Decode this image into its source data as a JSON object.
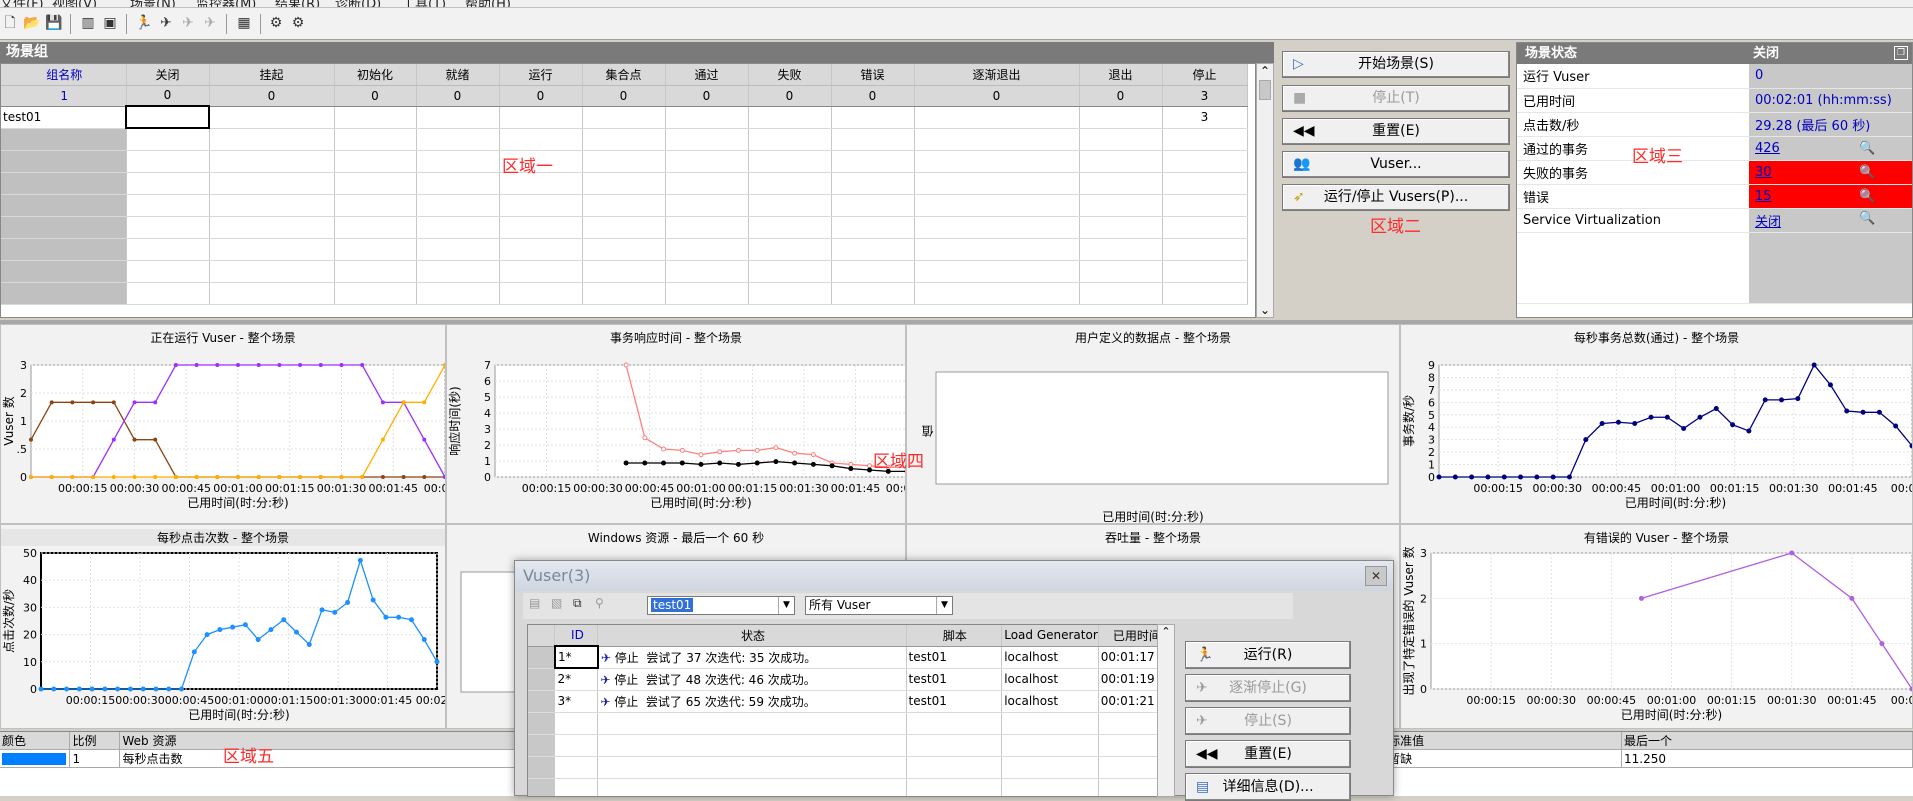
{
  "menu": [
    "文件(F)",
    "视图(V)",
    "场景(N)",
    "监控器(M)",
    "结果(R)",
    "诊断(D)",
    "工具(T)",
    "帮助(H)"
  ],
  "scenario_group": {
    "title": "场景组",
    "columns": [
      "组名称",
      "关闭",
      "挂起",
      "初始化",
      "就绪",
      "运行",
      "集合点",
      "通过",
      "失败",
      "错误",
      "逐渐退出",
      "退出",
      "停止"
    ],
    "totals": [
      "1",
      "0",
      "0",
      "0",
      "0",
      "0",
      "0",
      "0",
      "0",
      "0",
      "0",
      "0",
      "3"
    ],
    "rows": [
      {
        "name": "test01",
        "stop": "3"
      }
    ]
  },
  "annotations": {
    "area1": "区域一",
    "area2": "区域二",
    "area3": "区域三",
    "area4": "区域四",
    "area5": "区域五"
  },
  "controls": {
    "start": "开始场景(S)",
    "stop": "停止(T)",
    "reset": "重置(E)",
    "vusers": "Vuser...",
    "run_stop_vusers": "运行/停止 Vusers(P)..."
  },
  "scenario_status": {
    "title": "场景状态",
    "close_label": "关闭",
    "rows": [
      {
        "label": "运行 Vuser",
        "value": "0"
      },
      {
        "label": "已用时间",
        "value": "00:02:01 (hh:mm:ss)"
      },
      {
        "label": "点击数/秒",
        "value": "29.28 (最后 60 秒)"
      },
      {
        "label": "通过的事务",
        "value": "426"
      },
      {
        "label": "失败的事务",
        "value": "30"
      },
      {
        "label": "错误",
        "value": "15"
      },
      {
        "label": "Service Virtualization",
        "value": "关闭"
      }
    ]
  },
  "graphs": {
    "running_vusers": "正在运行 Vuser - 整个场景",
    "txn_response": "事务响应时间 - 整个场景",
    "user_defined": "用户定义的数据点 - 整个场景",
    "tps": "每秒事务总数(通过) - 整个场景",
    "hits": "每秒点击次数 - 整个场景",
    "windows": "Windows 资源 - 最后一个 60 秒",
    "throughput": "吞吐量 - 整个场景",
    "error_vusers": "有错误的 Vuser - 整个场景",
    "elapsed_label": "已用时间(时:分:秒)",
    "x_ticks": [
      "00:00:15",
      "00:00:30",
      "00:00:45",
      "00:01:00",
      "00:01:15",
      "00:01:30",
      "00:01:45",
      "00:02:0"
    ],
    "ylabels": {
      "running_vusers": "Vuser 数",
      "txn_response": "响应时间(秒)",
      "user_defined": "值",
      "tps": "事务数/秒",
      "hits": "点击次数/秒",
      "error_vusers": "出现了特定错误的 Vuser 数"
    }
  },
  "chart_data": [
    {
      "type": "line",
      "title": "正在运行 Vuser - 整个场景",
      "xlabel": "已用时间(时:分:秒)",
      "ylabel": "Vuser 数",
      "ylim": [
        0,
        3
      ],
      "yticks": [
        "3",
        "2",
        "1",
        ".5",
        "0"
      ],
      "series": [
        {
          "color": "#8b4513",
          "values": [
            1,
            2,
            2,
            2,
            2,
            1,
            1,
            0,
            0,
            0,
            0,
            0,
            0,
            0,
            0,
            0,
            0,
            0,
            0,
            0,
            0
          ]
        },
        {
          "color": "#9b30ff",
          "values": [
            0,
            0,
            0,
            0,
            1,
            2,
            2,
            3,
            3,
            3,
            3,
            3,
            3,
            3,
            3,
            3,
            3,
            2,
            2,
            1,
            0
          ]
        },
        {
          "color": "#ffb000",
          "values": [
            0,
            0,
            0,
            0,
            0,
            0,
            0,
            0,
            0,
            0,
            0,
            0,
            0,
            0,
            0,
            0,
            0,
            1,
            2,
            2,
            3
          ]
        }
      ]
    },
    {
      "type": "line",
      "title": "事务响应时间 - 整个场景",
      "xlabel": "已用时间(时:分:秒)",
      "ylabel": "响应时间(秒)",
      "ylim": [
        0,
        8
      ],
      "yticks": [
        "7",
        "6",
        "5",
        "4",
        "3",
        "2",
        "1",
        "0"
      ],
      "series": [
        {
          "color": "#ff8080",
          "values": [
            null,
            null,
            null,
            null,
            null,
            null,
            null,
            8,
            2.8,
            2,
            1.9,
            1.6,
            1.8,
            1.9,
            1.9,
            2.1,
            1.7,
            1.6,
            1,
            0.9,
            0.8,
            0.7,
            0.7
          ]
        },
        {
          "color": "#000000",
          "values": [
            null,
            null,
            null,
            null,
            null,
            null,
            null,
            1,
            1,
            1,
            1,
            0.9,
            1,
            0.9,
            1,
            1.1,
            1,
            0.9,
            0.8,
            0.6,
            0.5,
            0.4,
            0.4
          ]
        }
      ]
    },
    {
      "type": "line",
      "title": "每秒事务总数(通过) - 整个场景",
      "xlabel": "已用时间(时:分:秒)",
      "ylabel": "事务数/秒",
      "ylim": [
        0,
        9
      ],
      "yticks": [
        "9",
        "8",
        "7",
        "6",
        "5",
        "4",
        "3",
        "2",
        "1",
        "0"
      ],
      "series": [
        {
          "color": "#000080",
          "values": [
            0,
            0,
            0,
            0,
            0,
            0,
            0,
            0,
            0,
            3,
            4.3,
            4.4,
            4.3,
            4.8,
            4.8,
            3.9,
            4.8,
            5.5,
            4.2,
            3.7,
            6.2,
            6.2,
            6.3,
            9,
            7.4,
            5.3,
            5.2,
            5.2,
            4.1,
            2.5
          ]
        }
      ]
    },
    {
      "type": "line",
      "title": "每秒点击次数 - 整个场景",
      "xlabel": "已用时间(时:分:秒)",
      "ylabel": "点击次数/秒",
      "ylim": [
        0,
        55
      ],
      "yticks": [
        "50",
        "40",
        "30",
        "20",
        "10",
        "0"
      ],
      "series": [
        {
          "color": "#1e90ff",
          "values": [
            0,
            0,
            0,
            0,
            0,
            0,
            0,
            0,
            0,
            0,
            0,
            0,
            15,
            22,
            24,
            25,
            26,
            20,
            24,
            28,
            23,
            18,
            32,
            31,
            35,
            52,
            36,
            29,
            29,
            28,
            20,
            11
          ]
        }
      ]
    },
    {
      "type": "line",
      "title": "有错误的 Vuser - 整个场景",
      "xlabel": "已用时间(时:分:秒)",
      "ylabel": "出现了特定错误的 Vuser 数",
      "ylim": [
        0,
        3
      ],
      "yticks": [
        "3",
        "2",
        "1",
        "0"
      ],
      "series": [
        {
          "color": "#b060e0",
          "values": [
            null,
            null,
            null,
            null,
            null,
            null,
            null,
            2,
            null,
            null,
            null,
            null,
            3,
            null,
            2,
            1,
            0
          ]
        }
      ]
    }
  ],
  "vuser_dialog": {
    "title": "Vuser(3)",
    "group_select": "test01",
    "filter_select": "所有 Vuser",
    "columns": [
      "ID",
      "状态",
      "脚本",
      "Load Generator",
      "已用时间"
    ],
    "rows": [
      {
        "id": "1*",
        "status": "停止",
        "detail": "尝试了 37 次迭代: 35 次成功。",
        "script": "test01",
        "lg": "localhost",
        "time": "00:01:17"
      },
      {
        "id": "2*",
        "status": "停止",
        "detail": "尝试了 48 次迭代: 46 次成功。",
        "script": "test01",
        "lg": "localhost",
        "time": "00:01:19"
      },
      {
        "id": "3*",
        "status": "停止",
        "detail": "尝试了 65 次迭代: 59 次成功。",
        "script": "test01",
        "lg": "localhost",
        "time": "00:01:21"
      }
    ],
    "buttons": {
      "run": "运行(R)",
      "gradual_stop": "逐渐停止(G)",
      "stop": "停止(S)",
      "reset": "重置(E)",
      "details": "详细信息(D)..."
    }
  },
  "legend": {
    "columns": [
      "颜色",
      "比例",
      "Web 资源"
    ],
    "row": {
      "color": "#0080ff",
      "scale": "1",
      "resource": "每秒点击数"
    },
    "right_cols": [
      "标准值",
      "最后一个"
    ],
    "right_vals": [
      "暂缺",
      "11.250"
    ]
  }
}
